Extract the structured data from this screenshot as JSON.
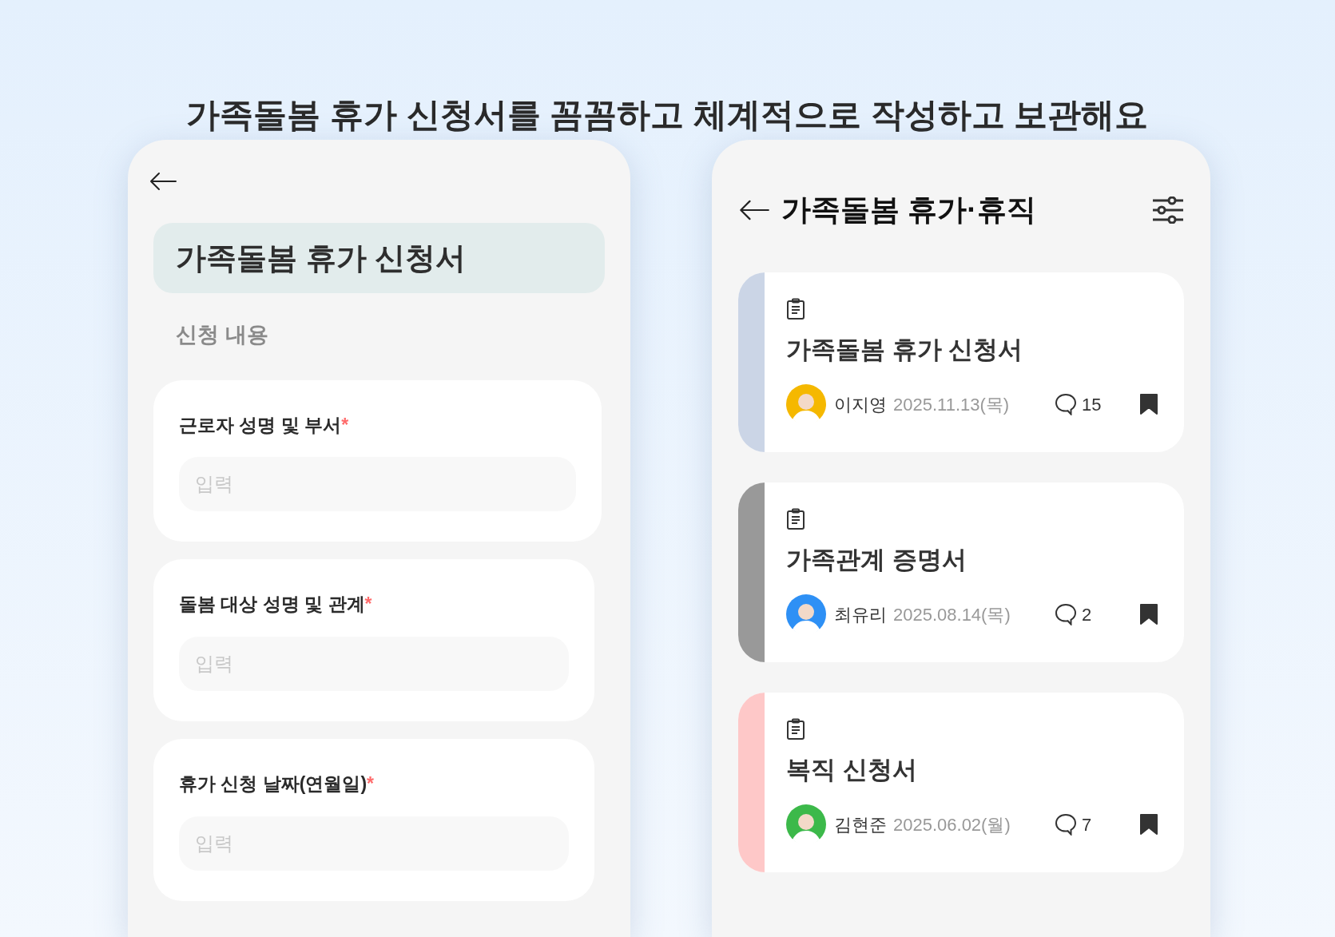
{
  "headline": "가족돌봄 휴가 신청서를 꼼꼼하고 체계적으로 작성하고 보관해요",
  "form_screen": {
    "title": "가족돌봄 휴가 신청서",
    "section": "신청 내용",
    "fields": [
      {
        "label": "근로자 성명 및 부서",
        "required_mark": "*",
        "placeholder": "입력"
      },
      {
        "label": "돌봄 대상 성명 및 관계",
        "required_mark": "*",
        "placeholder": "입력"
      },
      {
        "label": "휴가 신청 날짜(연월일)",
        "required_mark": "*",
        "placeholder": "입력"
      }
    ]
  },
  "list_screen": {
    "title": "가족돌봄 휴가·휴직",
    "documents": [
      {
        "title": "가족돌봄 휴가 신청서",
        "author": "이지영",
        "date": "2025.11.13(목)",
        "comments": "15",
        "bookmarked": true,
        "color": "#cbd5e6",
        "avatar": {
          "color": "#f5b800"
        }
      },
      {
        "title": "가족관계 증명서",
        "author": "최유리",
        "date": "2025.08.14(목)",
        "comments": "2",
        "bookmarked": true,
        "color": "#999999",
        "avatar": {
          "color": "#2e90f5"
        }
      },
      {
        "title": "복직 신청서",
        "author": "김현준",
        "date": "2025.06.02(월)",
        "comments": "7",
        "bookmarked": true,
        "color": "#fec8c8",
        "avatar": {
          "color": "#3cb94a"
        }
      }
    ]
  }
}
